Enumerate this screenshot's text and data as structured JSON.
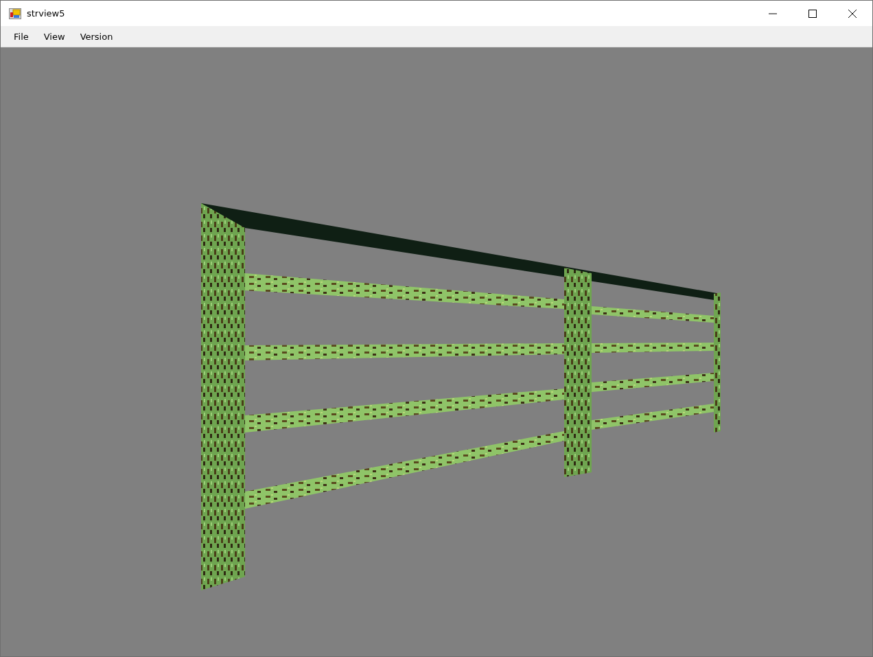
{
  "window": {
    "title": "strview5"
  },
  "menu": [
    {
      "label": "File"
    },
    {
      "label": "View"
    },
    {
      "label": "Version"
    }
  ]
}
